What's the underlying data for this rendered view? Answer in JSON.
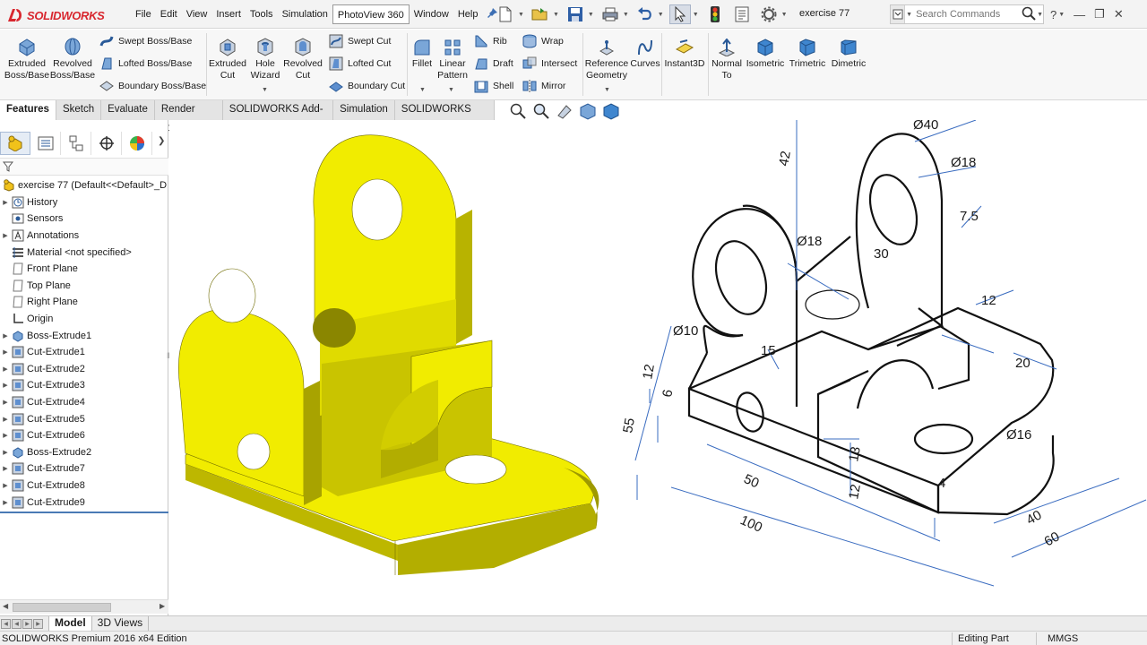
{
  "app": {
    "brand": "SOLIDWORKS",
    "document_title": "exercise 77"
  },
  "menu": [
    "File",
    "Edit",
    "View",
    "Insert",
    "Tools",
    "Simulation",
    "PhotoView 360",
    "Window",
    "Help"
  ],
  "menu_active": "PhotoView 360",
  "search": {
    "placeholder": "Search Commands"
  },
  "ribbon": {
    "extruded_boss": "Extruded Boss/Base",
    "revolved_boss": "Revolved Boss/Base",
    "swept_boss": "Swept Boss/Base",
    "lofted_boss": "Lofted Boss/Base",
    "boundary_boss": "Boundary Boss/Base",
    "extruded_cut": "Extruded Cut",
    "hole_wizard": "Hole Wizard",
    "revolved_cut": "Revolved Cut",
    "swept_cut": "Swept Cut",
    "lofted_cut": "Lofted Cut",
    "boundary_cut": "Boundary Cut",
    "fillet": "Fillet",
    "linear_pattern": "Linear Pattern",
    "rib": "Rib",
    "draft": "Draft",
    "shell": "Shell",
    "wrap": "Wrap",
    "intersect": "Intersect",
    "mirror": "Mirror",
    "reference_geometry": "Reference Geometry",
    "curves": "Curves",
    "instant3d": "Instant3D",
    "normal_to": "Normal To",
    "isometric": "Isometric",
    "trimetric": "Trimetric",
    "dimetric": "Dimetric"
  },
  "cm_tabs": [
    "Features",
    "Sketch",
    "Evaluate",
    "Render Tools",
    "SOLIDWORKS Add-Ins",
    "Simulation",
    "SOLIDWORKS MBD"
  ],
  "cm_active": "Features",
  "tree": [
    {
      "label": "exercise 77  (Default<<Default>_D",
      "icon": "part-icon",
      "expand": false
    },
    {
      "label": "History",
      "icon": "history-icon",
      "expand": true
    },
    {
      "label": "Sensors",
      "icon": "sensors-icon",
      "expand": false
    },
    {
      "label": "Annotations",
      "icon": "annotations-icon",
      "expand": true
    },
    {
      "label": "Material <not specified>",
      "icon": "material-icon",
      "expand": false
    },
    {
      "label": "Front Plane",
      "icon": "plane-icon",
      "expand": false
    },
    {
      "label": "Top Plane",
      "icon": "plane-icon",
      "expand": false
    },
    {
      "label": "Right Plane",
      "icon": "plane-icon",
      "expand": false
    },
    {
      "label": "Origin",
      "icon": "origin-icon",
      "expand": false
    },
    {
      "label": "Boss-Extrude1",
      "icon": "boss-extrude-icon",
      "expand": true
    },
    {
      "label": "Cut-Extrude1",
      "icon": "cut-extrude-icon",
      "expand": true
    },
    {
      "label": "Cut-Extrude2",
      "icon": "cut-extrude-icon",
      "expand": true
    },
    {
      "label": "Cut-Extrude3",
      "icon": "cut-extrude-icon",
      "expand": true
    },
    {
      "label": "Cut-Extrude4",
      "icon": "cut-extrude-icon",
      "expand": true
    },
    {
      "label": "Cut-Extrude5",
      "icon": "cut-extrude-icon",
      "expand": true
    },
    {
      "label": "Cut-Extrude6",
      "icon": "cut-extrude-icon",
      "expand": true
    },
    {
      "label": "Boss-Extrude2",
      "icon": "boss-extrude-icon",
      "expand": true
    },
    {
      "label": "Cut-Extrude7",
      "icon": "cut-extrude-icon",
      "expand": true
    },
    {
      "label": "Cut-Extrude8",
      "icon": "cut-extrude-icon",
      "expand": true
    },
    {
      "label": "Cut-Extrude9",
      "icon": "cut-extrude-icon",
      "expand": true
    }
  ],
  "drawing_dims": {
    "d40": "Ø40",
    "d18_top": "Ø18",
    "v42": "42",
    "v7_5": "7.5",
    "d18_left": "Ø18",
    "v30": "30",
    "v12_a": "12",
    "d10": "Ø10",
    "v15": "15",
    "v12_b": "12",
    "v6": "6",
    "v55": "55",
    "v20": "20",
    "d16": "Ø16",
    "v13": "13",
    "v12_c": "12",
    "v4": "4",
    "v50": "50",
    "v100": "100",
    "v40": "40",
    "v60": "60"
  },
  "bottom_tabs": [
    "Model",
    "3D Views"
  ],
  "bottom_active": "Model",
  "status": {
    "edition": "SOLIDWORKS Premium 2016 x64 Edition",
    "mode": "Editing Part",
    "units": "MMGS"
  },
  "colors": {
    "model_face_top": "#f1ec00",
    "model_face_side": "#c9c400",
    "model_face_dark": "#8c8800",
    "brand_red": "#d8262e",
    "dim_blue": "#3a6cc0"
  }
}
